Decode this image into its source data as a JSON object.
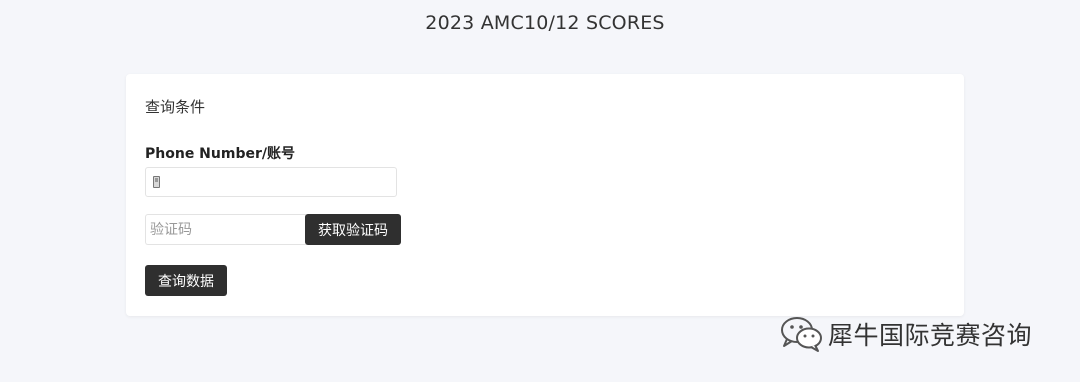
{
  "page": {
    "title": "2023 AMC10/12 SCORES"
  },
  "query_card": {
    "title": "查询条件",
    "phone_label": "Phone Number/账号",
    "phone_value": "",
    "phone_placeholder": "",
    "code_value": "",
    "code_placeholder": "验证码",
    "get_code_label": "获取验证码",
    "query_label": "查询数据"
  },
  "watermark": {
    "icon": "wechat-icon",
    "text": "犀牛国际竞赛咨询"
  },
  "colors": {
    "background": "#f5f6fa",
    "card": "#ffffff",
    "button": "#2f2f2f",
    "button_text": "#ffffff"
  }
}
